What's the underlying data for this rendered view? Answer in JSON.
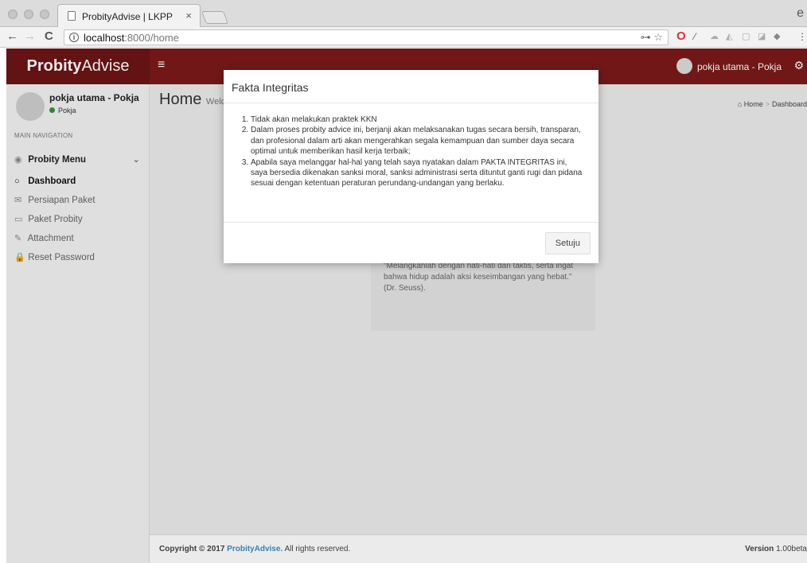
{
  "browser": {
    "tab_title": "ProbityAdvise | LKPP",
    "tab_close": "×",
    "url_host": "localhost",
    "url_rest": ":8000/home",
    "back": "←",
    "forward": "→",
    "reload": "C",
    "key_icon": "⊶",
    "star": "☆"
  },
  "header": {
    "logo_bold": "Probity",
    "logo_light": "Advise",
    "menu_toggle": "≡",
    "user_name": "pokja utama - Pokja",
    "settings": "⚙"
  },
  "sidebar": {
    "user_name": "pokja utama - Pokja",
    "user_status": "Pokja",
    "nav_header": "MAIN NAVIGATION",
    "tree_label": "Probity Menu",
    "chevron": "⌄",
    "items": [
      {
        "label": "Dashboard",
        "icon": "○"
      },
      {
        "label": "Persiapan Paket",
        "icon": "✉"
      },
      {
        "label": "Paket Probity",
        "icon": "▭"
      },
      {
        "label": "Attachment",
        "icon": "✎"
      },
      {
        "label": "Reset Password",
        "icon": "🔒"
      }
    ]
  },
  "content": {
    "title": "Home",
    "subtitle": "Welco",
    "breadcrumb_home": "Home",
    "breadcrumb_current": "Dashboard",
    "quote": "\"Melangkahlah dengan hati-hati dan taktis, serta ingat bahwa hidup adalah aksi keseimbangan yang hebat.\" (Dr. Seuss)."
  },
  "footer": {
    "copyright_prefix": "Copyright © 2017",
    "brand": "ProbityAdvise.",
    "rights": "All rights reserved.",
    "version_label": "Version",
    "version_value": "1.00beta"
  },
  "modal": {
    "title": "Fakta Integritas",
    "items": [
      "Tidak akan melakukan praktek KKN",
      "Dalam proses probity advice ini, berjanji akan melaksanakan tugas secara bersih, transparan, dan profesional dalam arti akan mengerahkan segala kemampuan dan sumber daya secara optimal untuk memberikan hasil kerja terbaik;",
      "Apabila saya melanggar hal-hal yang telah saya nyatakan dalam PAKTA INTEGRITAS ini, saya bersedia dikenakan sanksi moral, sanksi administrasi serta dituntut ganti rugi dan pidana sesuai dengan ketentuan peraturan perundang-undangan yang berlaku."
    ],
    "confirm_label": "Setuju"
  }
}
